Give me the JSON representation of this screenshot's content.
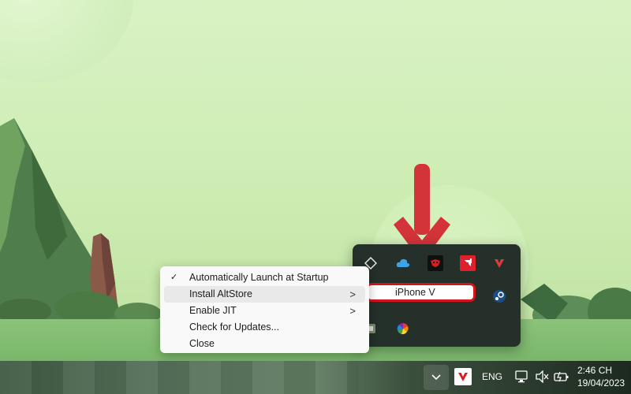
{
  "context_menu": {
    "items": [
      {
        "label": "Automatically Launch at Startup",
        "checked": true,
        "has_submenu": false
      },
      {
        "label": "Install AltStore",
        "checked": false,
        "has_submenu": true,
        "highlighted": true
      },
      {
        "label": "Enable JIT",
        "checked": false,
        "has_submenu": true
      },
      {
        "label": "Check for Updates...",
        "checked": false,
        "has_submenu": false
      },
      {
        "label": "Close",
        "checked": false,
        "has_submenu": false
      }
    ],
    "check_glyph": "✓",
    "submenu_glyph": ">"
  },
  "device_submenu": {
    "label": "iPhone V",
    "highlight_color": "#d3141d"
  },
  "tray_flyout": {
    "icons": [
      "altstore-diamond-icon",
      "icloud-icon",
      "app-red-mask-icon",
      "amd-icon",
      "vivaldi-icon",
      "steam-icon",
      "app-small-icon",
      "color-wheel-icon"
    ]
  },
  "taskbar": {
    "language": "ENG",
    "time": "2:46 CH",
    "date": "19/04/2023",
    "icons": [
      "chevron-up-icon",
      "vivaldi-icon",
      "network-icon",
      "volume-muted-icon",
      "battery-icon"
    ]
  },
  "annotation": {
    "arrow_color": "#d3343a"
  }
}
